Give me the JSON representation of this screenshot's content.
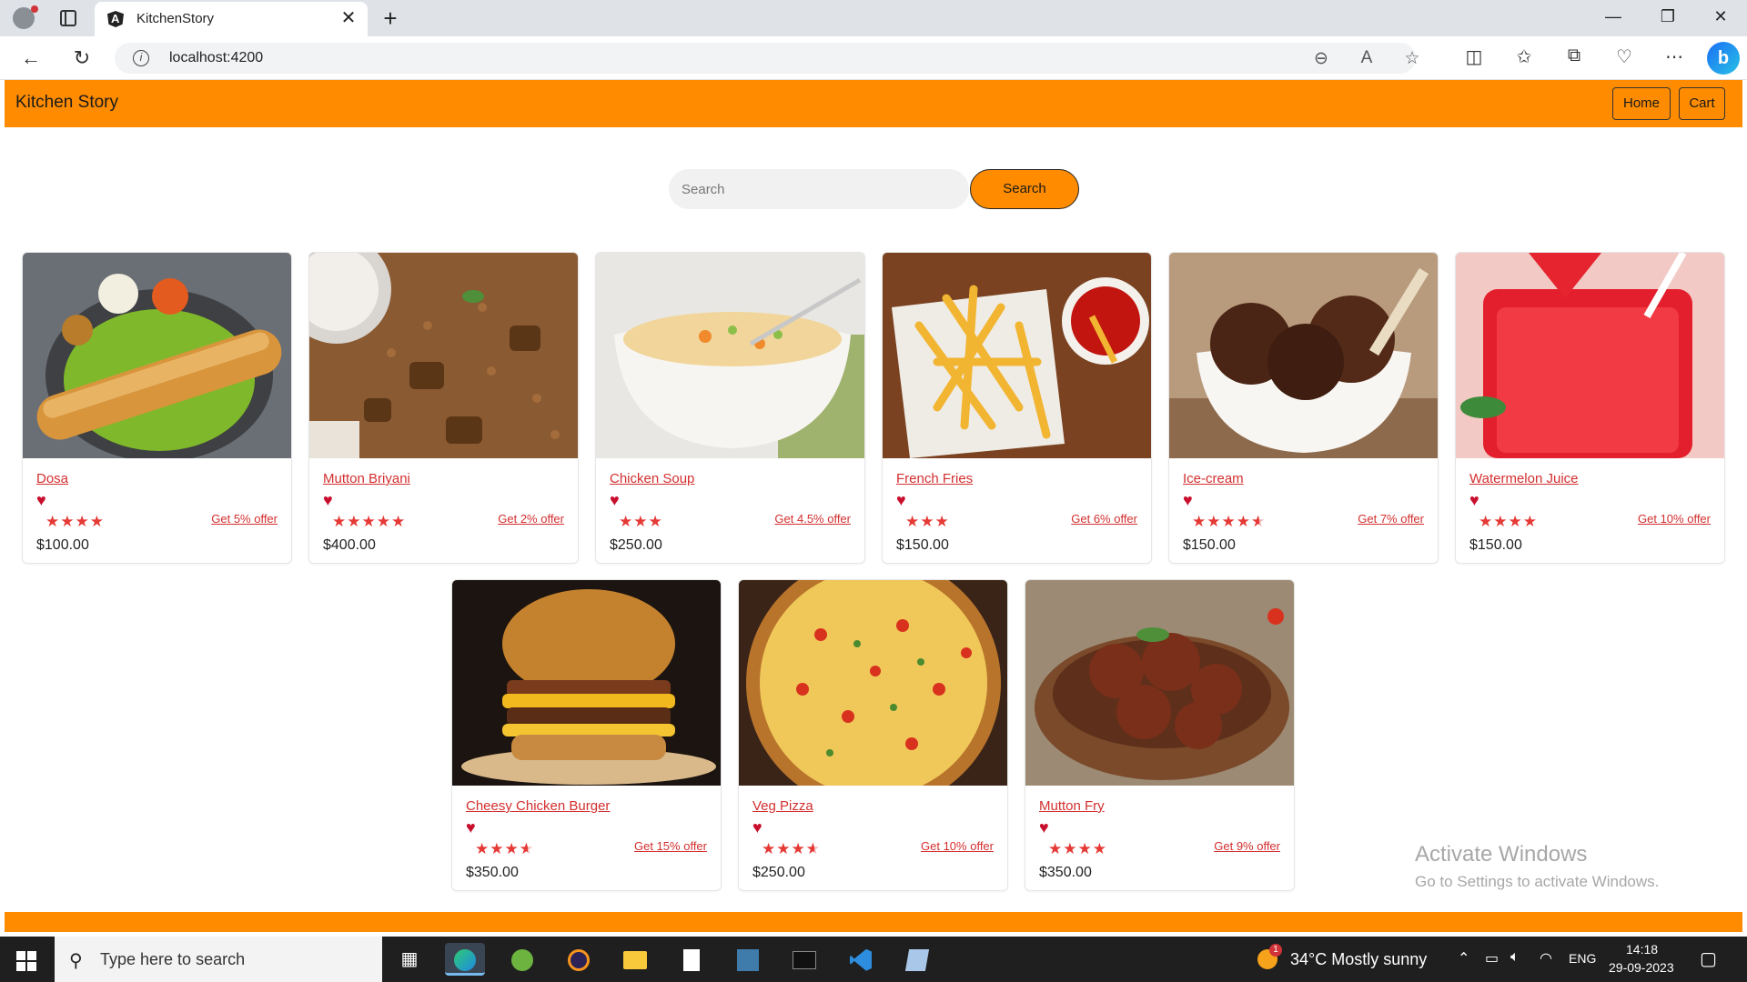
{
  "browser": {
    "tab_title": "KitchenStory",
    "url": "localhost:4200",
    "tab_close_glyph": "✕",
    "new_tab_glyph": "+",
    "minimize_glyph": "—",
    "maximize_glyph": "❐",
    "close_glyph": "✕",
    "back_glyph": "←",
    "reload_glyph": "↻",
    "copilot_glyph": "b",
    "info_glyph": "i"
  },
  "navbar": {
    "brand": "Kitchen Story",
    "home_label": "Home",
    "cart_label": "Cart",
    "accent_color": "#ff8c00"
  },
  "search": {
    "placeholder": "Search",
    "button_label": "Search"
  },
  "products": [
    {
      "name": "Dosa",
      "rating": 4,
      "offer": "Get 5% offer",
      "price": "$100.00"
    },
    {
      "name": "Mutton Briyani",
      "rating": 5,
      "offer": "Get 2% offer",
      "price": "$400.00"
    },
    {
      "name": "Chicken Soup",
      "rating": 3,
      "offer": "Get 4.5% offer",
      "price": "$250.00"
    },
    {
      "name": "French Fries",
      "rating": 3,
      "offer": "Get 6% offer",
      "price": "$150.00"
    },
    {
      "name": "Ice-cream",
      "rating": 4.5,
      "offer": "Get 7% offer",
      "price": "$150.00"
    },
    {
      "name": "Watermelon Juice",
      "rating": 4,
      "offer": "Get 10% offer",
      "price": "$150.00"
    },
    {
      "name": "Cheesy Chicken Burger",
      "rating": 3.5,
      "offer": "Get 15% offer",
      "price": "$350.00"
    },
    {
      "name": "Veg Pizza",
      "rating": 3.5,
      "offer": "Get 10% offer",
      "price": "$250.00"
    },
    {
      "name": "Mutton Fry",
      "rating": 4,
      "offer": "Get 9% offer",
      "price": "$350.00"
    }
  ],
  "watermark": {
    "line1": "Activate Windows",
    "line2": "Go to Settings to activate Windows."
  },
  "taskbar": {
    "search_placeholder": "Type here to search",
    "weather": "34°C  Mostly sunny",
    "weather_badge": "1",
    "language": "ENG",
    "time": "14:18",
    "date": "29-09-2023"
  }
}
